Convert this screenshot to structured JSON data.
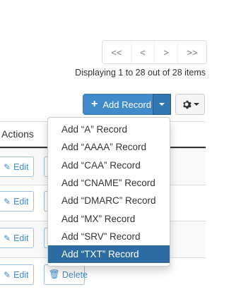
{
  "pagination": {
    "first": "<<",
    "prev": "<",
    "next": ">",
    "last": ">>"
  },
  "summary": "Displaying 1 to 28 out of 28 items",
  "toolbar": {
    "add_record_label": "Add Record"
  },
  "table": {
    "actions_header": "Actions"
  },
  "row_actions": {
    "edit_label": "Edit",
    "delete_label": "Delete"
  },
  "add_menu": {
    "items": [
      "Add “A” Record",
      "Add “AAAA” Record",
      "Add “CAA” Record",
      "Add “CNAME” Record",
      "Add “DMARC” Record",
      "Add “MX” Record",
      "Add “SRV” Record",
      "Add “TXT” Record"
    ],
    "highlighted": "Add “TXT” Record"
  },
  "colors": {
    "primary": "#428bca",
    "menu_highlight": "#2d6ca2"
  },
  "icons": {
    "add": "plus-icon",
    "settings": "gear-icon",
    "edit": "pencil-icon",
    "delete": "trash-icon"
  }
}
